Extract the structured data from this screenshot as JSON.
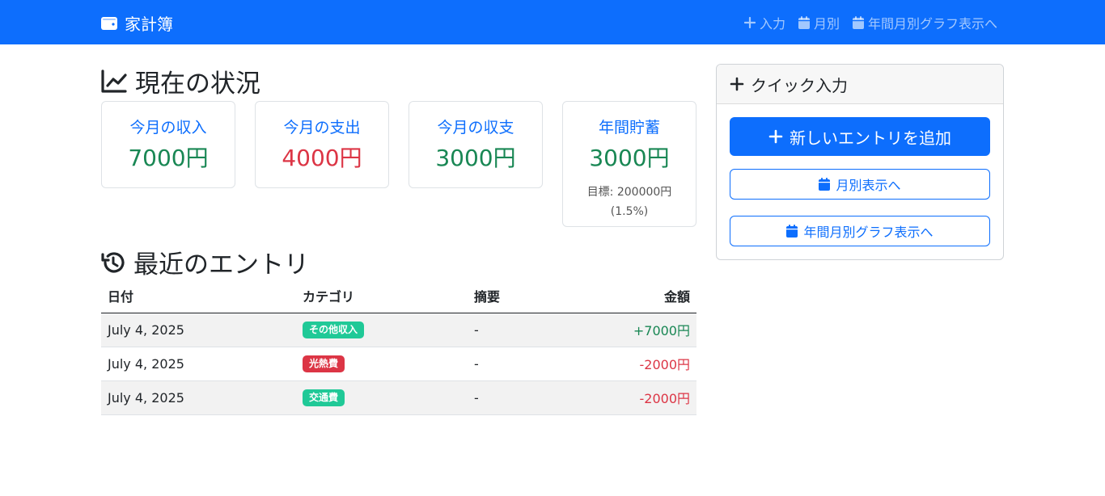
{
  "navbar": {
    "brand": "家計簿",
    "links": [
      {
        "label": "入力",
        "icon": "plus-icon"
      },
      {
        "label": "月別",
        "icon": "calendar-icon"
      },
      {
        "label": "年間月別グラフ表示へ",
        "icon": "calendar-icon"
      }
    ]
  },
  "status": {
    "title": "現在の状況",
    "cards": [
      {
        "label": "今月の収入",
        "value": "7000円",
        "color": "#198754"
      },
      {
        "label": "今月の支出",
        "value": "4000円",
        "color": "#dc3545"
      },
      {
        "label": "今月の収支",
        "value": "3000円",
        "color": "#198754"
      },
      {
        "label": "年間貯蓄",
        "value": "3000円",
        "color": "#198754",
        "note": "目標: 200000円 (1.5%)"
      }
    ]
  },
  "recent": {
    "title": "最近のエントリ",
    "columns": [
      "日付",
      "カテゴリ",
      "摘要",
      "金額"
    ],
    "rows": [
      {
        "date": "July 4, 2025",
        "category": "その他収入",
        "category_color": "#20c997",
        "memo": "-",
        "amount": "+7000円",
        "amount_color": "#198754"
      },
      {
        "date": "July 4, 2025",
        "category": "光熱費",
        "category_color": "#dc3545",
        "memo": "-",
        "amount": "-2000円",
        "amount_color": "#dc3545"
      },
      {
        "date": "July 4, 2025",
        "category": "交通費",
        "category_color": "#20c997",
        "memo": "-",
        "amount": "-2000円",
        "amount_color": "#dc3545"
      }
    ]
  },
  "quick": {
    "title": "クイック入力",
    "add_button": "新しいエントリを追加",
    "monthly_button": "月別表示へ",
    "yearly_button": "年間月別グラフ表示へ"
  },
  "colors": {
    "primary": "#0d6efd",
    "income": "#198754",
    "expense": "#dc3545"
  }
}
